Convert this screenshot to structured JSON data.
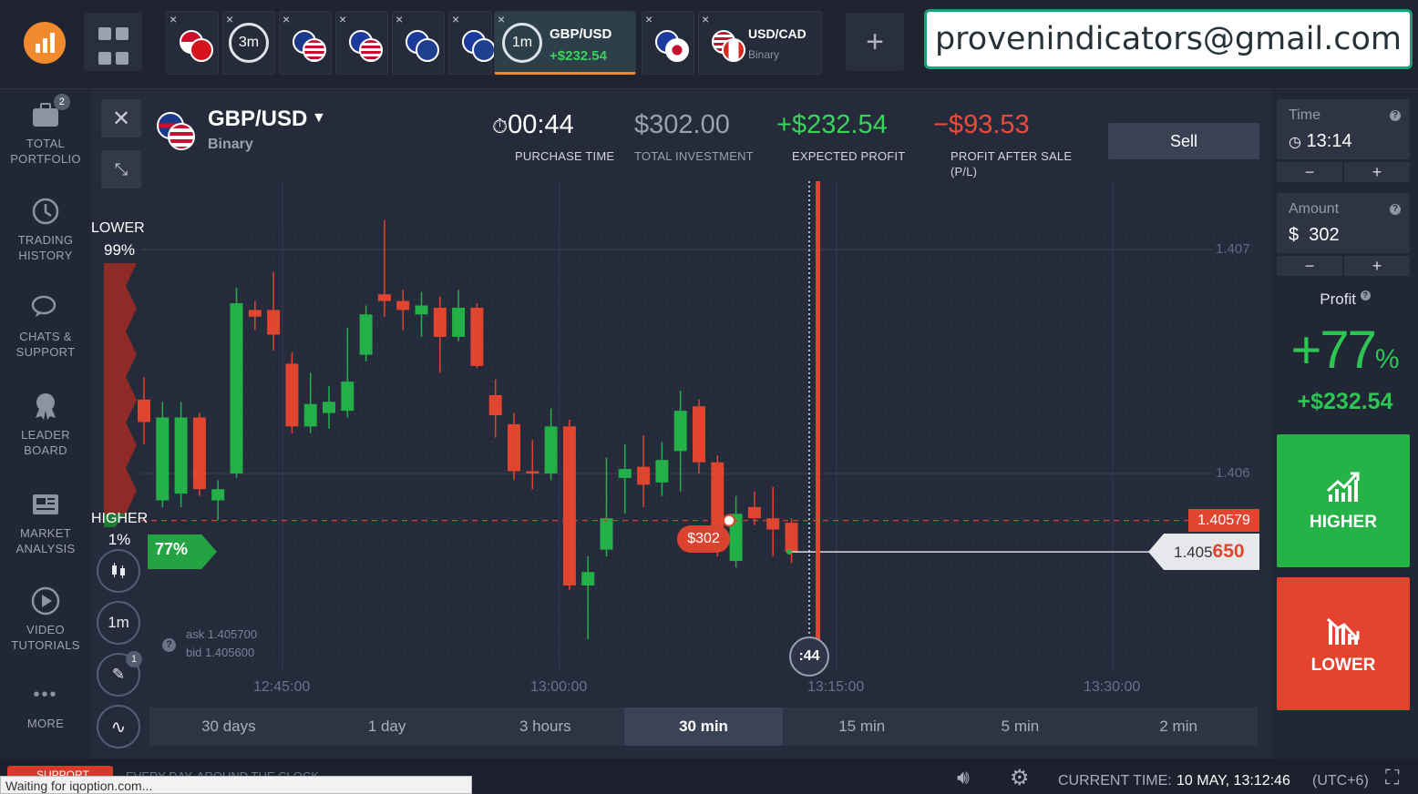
{
  "header": {
    "tabs": [
      {
        "kind": "flags",
        "title": "",
        "sub": ""
      },
      {
        "kind": "timer",
        "timer": "3m"
      },
      {
        "kind": "flags",
        "title": "",
        "sub": ""
      },
      {
        "kind": "flags",
        "title": "",
        "sub": ""
      },
      {
        "kind": "flags",
        "title": "",
        "sub": ""
      },
      {
        "kind": "flags",
        "title": "",
        "sub": ""
      },
      {
        "kind": "timer-active",
        "timer": "1m",
        "title": "GBP/USD",
        "sub": "+$232.54"
      },
      {
        "kind": "flags",
        "title": "",
        "sub": ""
      },
      {
        "kind": "flags",
        "title": "USD/CAD",
        "sub": "Binary"
      }
    ],
    "close_glyph": "×",
    "add_glyph": "+",
    "email": "provenindicators@gmail.com"
  },
  "nav": {
    "portfolio_badge": "2",
    "items": [
      {
        "l1": "TOTAL",
        "l2": "PORTFOLIO"
      },
      {
        "l1": "TRADING",
        "l2": "HISTORY"
      },
      {
        "l1": "CHATS &",
        "l2": "SUPPORT"
      },
      {
        "l1": "LEADER",
        "l2": "BOARD"
      },
      {
        "l1": "MARKET",
        "l2": "ANALYSIS"
      },
      {
        "l1": "VIDEO",
        "l2": "TUTORIALS"
      },
      {
        "l1": "MORE",
        "l2": ""
      }
    ],
    "more_glyph": "•••"
  },
  "asset": {
    "name": "GBP/USD",
    "type": "Binary"
  },
  "stats": {
    "purchase_time": "00:44",
    "purchase_time_label": "PURCHASE TIME",
    "total_investment": "$302.00",
    "total_investment_label": "TOTAL INVESTMENT",
    "expected_profit": "+$232.54",
    "expected_profit_label": "EXPECTED PROFIT",
    "profit_after_sale": "−$93.53",
    "profit_after_sale_label_1": "PROFIT AFTER SALE",
    "profit_after_sale_label_2": "(P/L)",
    "sell_label": "Sell"
  },
  "sentiment": {
    "lower_label": "LOWER",
    "lower_pct": "99%",
    "higher_label": "HIGHER",
    "higher_pct": "1%",
    "payout_badge": "77%"
  },
  "tools": {
    "timeframe": "1m",
    "drawings_badge": "1"
  },
  "quote": {
    "ask": "ask 1.405700",
    "bid": "bid 1.405600",
    "help": "?"
  },
  "chart_data": {
    "type": "candlestick",
    "price_ticks": [
      "1.407",
      "1.406"
    ],
    "time_ticks": [
      "12:45:00",
      "13:00:00",
      "13:15:00",
      "13:30:00"
    ],
    "deal_price": "1.40579",
    "current_price_main": "1.405",
    "current_price_tail": "650",
    "deal_amount": "$302",
    "expiry_countdown": ":44",
    "up_color": "#24b048",
    "down_color": "#e0452f",
    "candles": [
      {
        "o": 1.40633,
        "c": 1.40623,
        "h": 1.40643,
        "l": 1.40613
      },
      {
        "o": 1.40588,
        "c": 1.40625,
        "h": 1.40632,
        "l": 1.40585
      },
      {
        "o": 1.40591,
        "c": 1.40625,
        "h": 1.40632,
        "l": 1.40585
      },
      {
        "o": 1.40625,
        "c": 1.40593,
        "h": 1.40627,
        "l": 1.4059
      },
      {
        "o": 1.40588,
        "c": 1.40593,
        "h": 1.40597,
        "l": 1.40579
      },
      {
        "o": 1.406,
        "c": 1.40676,
        "h": 1.40683,
        "l": 1.40598
      },
      {
        "o": 1.40673,
        "c": 1.4067,
        "h": 1.40677,
        "l": 1.40664
      },
      {
        "o": 1.40673,
        "c": 1.40662,
        "h": 1.4069,
        "l": 1.40655
      },
      {
        "o": 1.40649,
        "c": 1.40621,
        "h": 1.40654,
        "l": 1.40618
      },
      {
        "o": 1.40621,
        "c": 1.40631,
        "h": 1.40645,
        "l": 1.40618
      },
      {
        "o": 1.40627,
        "c": 1.40632,
        "h": 1.40639,
        "l": 1.4062
      },
      {
        "o": 1.40628,
        "c": 1.40641,
        "h": 1.40665,
        "l": 1.40625
      },
      {
        "o": 1.40653,
        "c": 1.40671,
        "h": 1.40675,
        "l": 1.4065
      },
      {
        "o": 1.4068,
        "c": 1.40677,
        "h": 1.40713,
        "l": 1.4067
      },
      {
        "o": 1.40677,
        "c": 1.40673,
        "h": 1.40682,
        "l": 1.40664
      },
      {
        "o": 1.40671,
        "c": 1.40675,
        "h": 1.40681,
        "l": 1.40661
      },
      {
        "o": 1.40674,
        "c": 1.40661,
        "h": 1.40679,
        "l": 1.40645
      },
      {
        "o": 1.40661,
        "c": 1.40674,
        "h": 1.40682,
        "l": 1.40659
      },
      {
        "o": 1.40674,
        "c": 1.40648,
        "h": 1.40676,
        "l": 1.40647
      },
      {
        "o": 1.40635,
        "c": 1.40626,
        "h": 1.40642,
        "l": 1.40616
      },
      {
        "o": 1.40622,
        "c": 1.40601,
        "h": 1.40627,
        "l": 1.40597
      },
      {
        "o": 1.40601,
        "c": 1.406,
        "h": 1.40615,
        "l": 1.40593
      },
      {
        "o": 1.406,
        "c": 1.40621,
        "h": 1.40629,
        "l": 1.40597
      },
      {
        "o": 1.40621,
        "c": 1.4055,
        "h": 1.40624,
        "l": 1.40548
      },
      {
        "o": 1.4055,
        "c": 1.40556,
        "h": 1.40563,
        "l": 1.40526
      },
      {
        "o": 1.40566,
        "c": 1.4058,
        "h": 1.40607,
        "l": 1.40563
      },
      {
        "o": 1.40598,
        "c": 1.40602,
        "h": 1.40613,
        "l": 1.40582
      },
      {
        "o": 1.40603,
        "c": 1.40595,
        "h": 1.40617,
        "l": 1.40585
      },
      {
        "o": 1.40596,
        "c": 1.40606,
        "h": 1.40614,
        "l": 1.4059
      },
      {
        "o": 1.4061,
        "c": 1.40628,
        "h": 1.40637,
        "l": 1.40592
      },
      {
        "o": 1.4063,
        "c": 1.40605,
        "h": 1.40633,
        "l": 1.406
      },
      {
        "o": 1.40605,
        "c": 1.40574,
        "h": 1.40608,
        "l": 1.40563
      },
      {
        "o": 1.40561,
        "c": 1.40582,
        "h": 1.4059,
        "l": 1.40558
      },
      {
        "o": 1.40585,
        "c": 1.4058,
        "h": 1.40592,
        "l": 1.40577
      },
      {
        "o": 1.4058,
        "c": 1.40575,
        "h": 1.40594,
        "l": 1.40563
      },
      {
        "o": 1.40578,
        "c": 1.40565,
        "h": 1.4058,
        "l": 1.4056
      }
    ]
  },
  "ranges": [
    "30 days",
    "1 day",
    "3 hours",
    "30 min",
    "15 min",
    "5 min",
    "2 min"
  ],
  "active_range": "30 min",
  "right": {
    "time_label": "Time",
    "time_value": "13:14",
    "amount_label": "Amount",
    "amount_value": "302",
    "currency": "$",
    "minus": "−",
    "plus": "+",
    "profit_label": "Profit",
    "profit_pct": "+77",
    "profit_pct_sign": "%",
    "profit_amount": "+$232.54",
    "higher_label": "HIGHER",
    "lower_label": "LOWER",
    "higher_color": "#25b247",
    "lower_color": "#e4432f"
  },
  "footer": {
    "support_label": "SUPPORT",
    "ticker": "EVERY DAY, AROUND THE CLOCK",
    "current_time_label": "CURRENT TIME:",
    "current_time_value": "10 MAY, 13:12:46",
    "timezone": "(UTC+6)",
    "status_text": "Waiting for iqoption.com..."
  }
}
